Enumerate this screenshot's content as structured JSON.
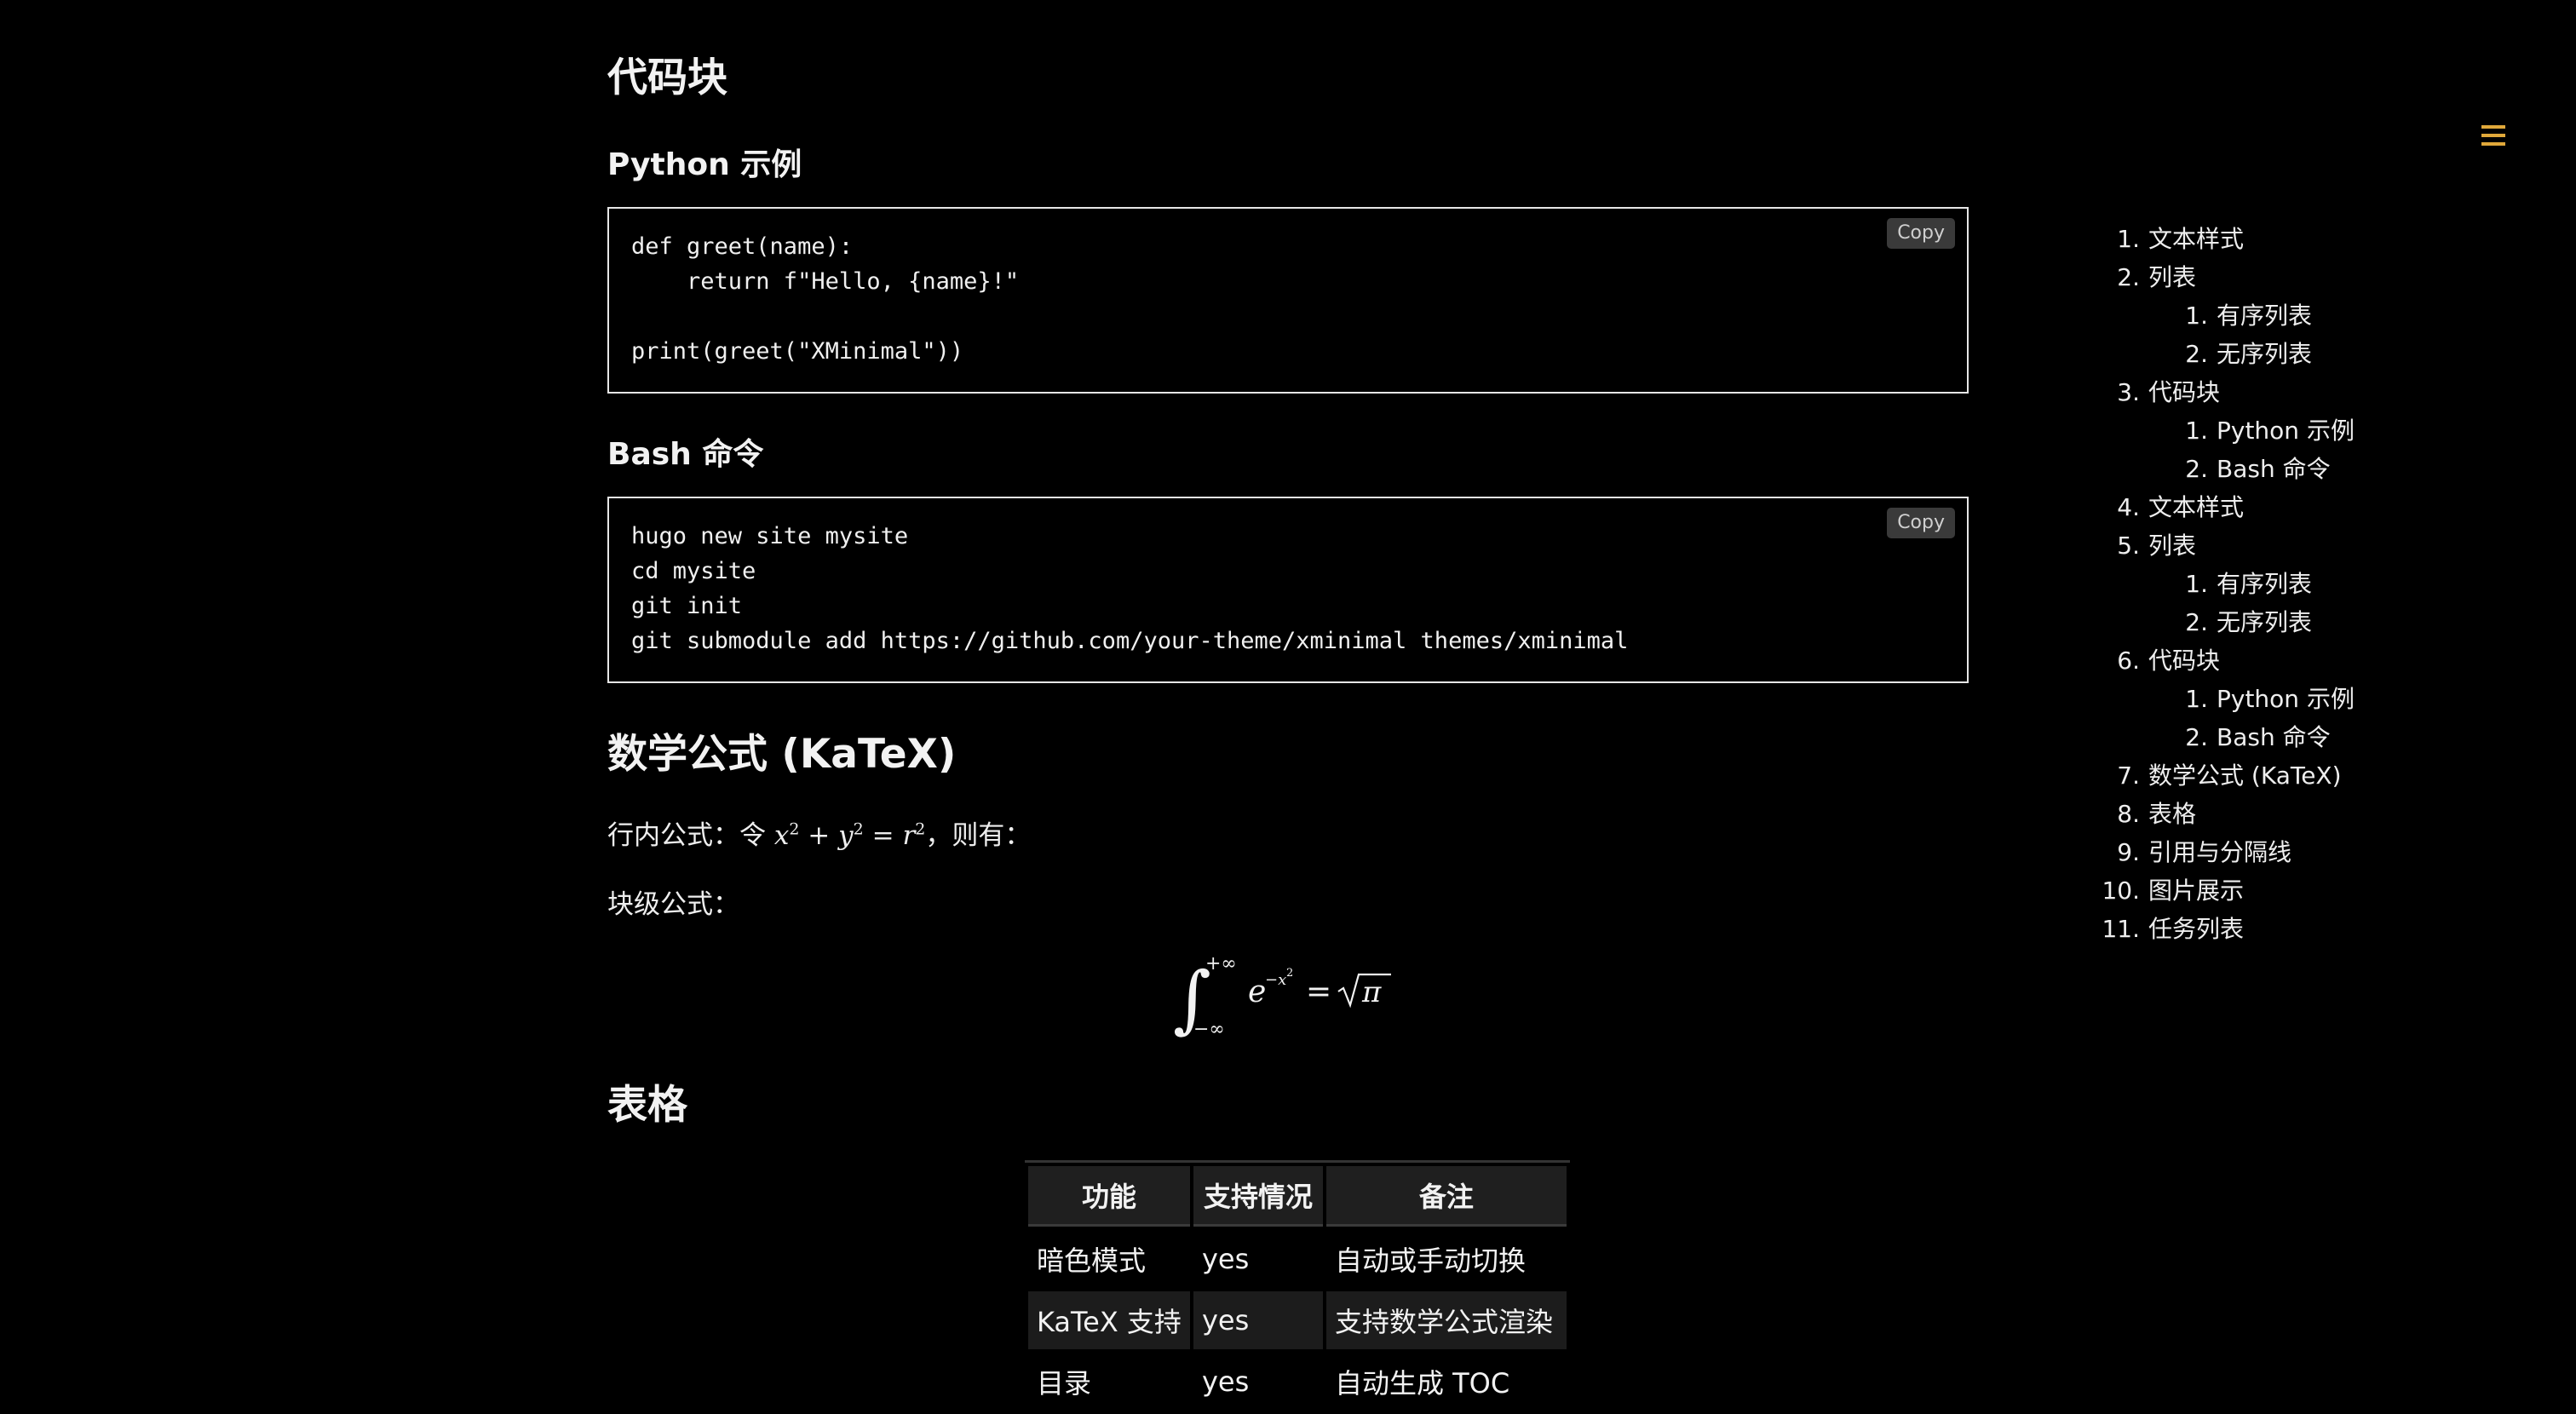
{
  "sections": {
    "code_heading": "代码块",
    "python_heading": "Python 示例",
    "bash_heading": "Bash 命令",
    "math_heading": "数学公式 (KaTeX)",
    "table_heading": "表格"
  },
  "code": {
    "copy_label": "Copy",
    "python": "def greet(name):\n    return f\"Hello, {name}!\"\n\nprint(greet(\"XMinimal\"))",
    "bash": "hugo new site mysite\ncd mysite\ngit init\ngit submodule add https://github.com/your-theme/xminimal themes/xminimal"
  },
  "math": {
    "inline_prefix": "行内公式：令",
    "inline_suffix": "，则有：",
    "block_label": "块级公式："
  },
  "table": {
    "headers": [
      "功能",
      "支持情况",
      "备注"
    ],
    "rows": [
      [
        "暗色模式",
        "yes",
        "自动或手动切换"
      ],
      [
        "KaTeX 支持",
        "yes",
        "支持数学公式渲染"
      ],
      [
        "目录",
        "yes",
        "自动生成 TOC"
      ]
    ]
  },
  "toc": {
    "items": [
      {
        "num": "1.",
        "label": "文本样式"
      },
      {
        "num": "2.",
        "label": "列表"
      },
      {
        "num": "1.",
        "label": "有序列表"
      },
      {
        "num": "2.",
        "label": "无序列表"
      },
      {
        "num": "3.",
        "label": "代码块"
      },
      {
        "num": "1.",
        "label": "Python 示例"
      },
      {
        "num": "2.",
        "label": "Bash 命令"
      },
      {
        "num": "4.",
        "label": "文本样式"
      },
      {
        "num": "5.",
        "label": "列表"
      },
      {
        "num": "1.",
        "label": "有序列表"
      },
      {
        "num": "2.",
        "label": "无序列表"
      },
      {
        "num": "6.",
        "label": "代码块"
      },
      {
        "num": "1.",
        "label": "Python 示例"
      },
      {
        "num": "2.",
        "label": "Bash 命令"
      },
      {
        "num": "7.",
        "label": "数学公式 (KaTeX)"
      },
      {
        "num": "8.",
        "label": "表格"
      },
      {
        "num": "9.",
        "label": "引用与分隔线"
      },
      {
        "num": "10.",
        "label": "图片展示"
      },
      {
        "num": "11.",
        "label": "任务列表"
      }
    ]
  },
  "icons": {
    "menu": "menu-icon"
  },
  "colors": {
    "accent": "#e0a83a",
    "background": "#000000"
  }
}
